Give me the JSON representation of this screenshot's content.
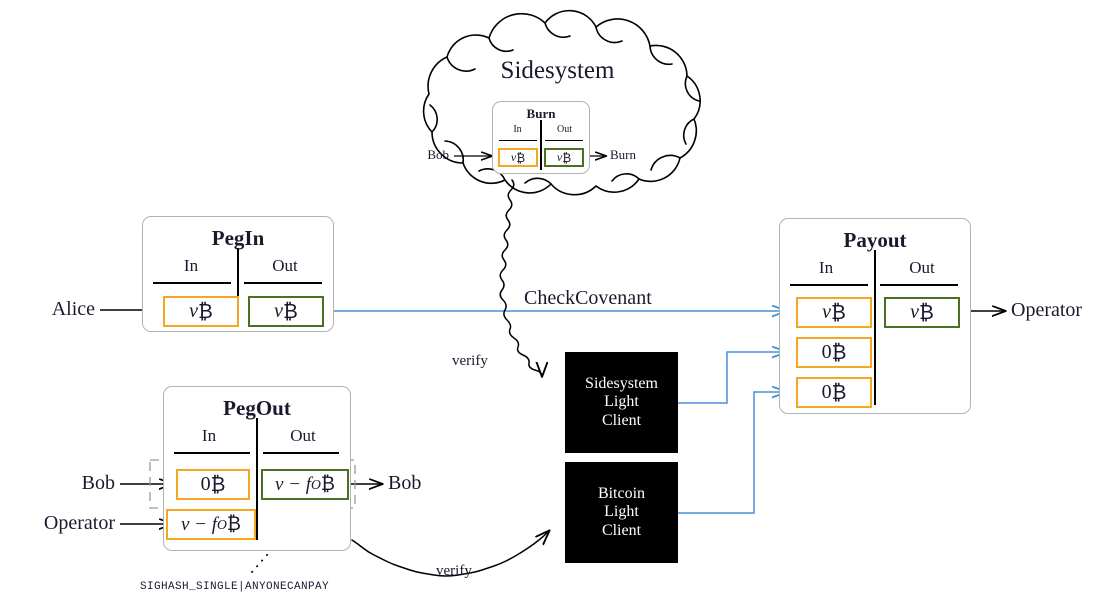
{
  "diagram": {
    "title_hidden": "Bitcoin sidesystem peg-in / peg-out covenant flow",
    "colors": {
      "input_border": "#f5a623",
      "output_border": "#4a7023",
      "connector_blue": "#4a90d9",
      "box_border": "#b3b3b3",
      "text": "#1a1a2e",
      "light_client_bg": "#000000"
    }
  },
  "cloud": {
    "label": "Sidesystem"
  },
  "burn_tx": {
    "title": "Burn",
    "col_in": "In",
    "col_out": "Out",
    "inputs": [
      {
        "value": "v",
        "unit": "₿"
      }
    ],
    "outputs": [
      {
        "value": "v",
        "unit": "₿"
      }
    ],
    "source_label": "Bob",
    "dest_label": "Burn"
  },
  "pegin_tx": {
    "title": "PegIn",
    "col_in": "In",
    "col_out": "Out",
    "inputs": [
      {
        "value": "v",
        "unit": "₿"
      }
    ],
    "outputs": [
      {
        "value": "v",
        "unit": "₿"
      }
    ],
    "source_label": "Alice"
  },
  "pegout_tx": {
    "title": "PegOut",
    "col_in": "In",
    "col_out": "Out",
    "inputs": [
      {
        "value": "0",
        "unit": "₿",
        "source_label": "Bob"
      },
      {
        "value": "v − f",
        "sub": "O",
        "unit": "₿",
        "source_label": "Operator"
      }
    ],
    "outputs": [
      {
        "value": "v − f",
        "sub": "O",
        "unit": "₿",
        "dest_label": "Bob"
      }
    ],
    "sighash_annotation": "SIGHASH_SINGLE|ANYONECANPAY"
  },
  "payout_tx": {
    "title": "Payout",
    "col_in": "In",
    "col_out": "Out",
    "inputs": [
      {
        "value": "v",
        "unit": "₿"
      },
      {
        "value": "0",
        "unit": "₿"
      },
      {
        "value": "0",
        "unit": "₿"
      }
    ],
    "outputs": [
      {
        "value": "v",
        "unit": "₿"
      }
    ],
    "dest_label": "Operator"
  },
  "light_clients": [
    {
      "id": "sidesystem-light-client",
      "lines": [
        "Sidesystem",
        "Light",
        "Client"
      ]
    },
    {
      "id": "bitcoin-light-client",
      "lines": [
        "Bitcoin",
        "Light",
        "Client"
      ]
    }
  ],
  "edge_labels": {
    "check_covenant": "CheckCovenant",
    "verify_top": "verify",
    "verify_bottom": "verify"
  }
}
